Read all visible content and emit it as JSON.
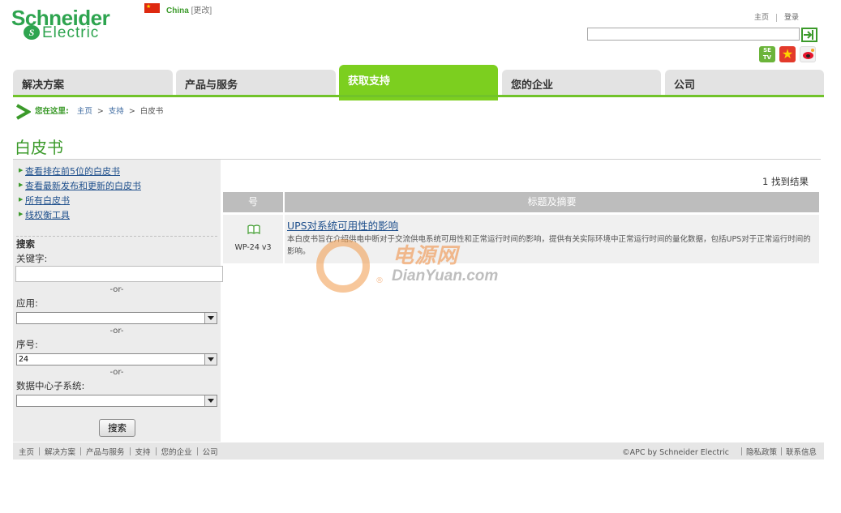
{
  "logo": {
    "line1": "Schneider",
    "line2": "Electric",
    "mark": "S"
  },
  "country": {
    "name": "China",
    "change": "[更改]"
  },
  "top_links": {
    "home": "主页",
    "login": "登录"
  },
  "search": {
    "placeholder": ""
  },
  "nav": {
    "tabs": [
      {
        "label": "解决方案"
      },
      {
        "label": "产品与服务"
      },
      {
        "label": "获取支持"
      },
      {
        "label": "您的企业"
      },
      {
        "label": "公司"
      }
    ],
    "active_tab": "获取支持",
    "accent_color": "#7ccf1f"
  },
  "breadcrumb": {
    "here_label": "您在这里:",
    "items": [
      "主页",
      "支持",
      "白皮书"
    ],
    "separator": ">"
  },
  "page": {
    "title": "白皮书"
  },
  "sidebar": {
    "links": [
      "查看排在前5位的白皮书",
      "查看最新发布和更新的白皮书",
      "所有白皮书",
      "线权衡工具"
    ],
    "search_heading": "搜索",
    "keyword_label": "关键字:",
    "or_text": "-or-",
    "application_label": "应用:",
    "application_value": "",
    "number_label": "序号:",
    "number_value": "24",
    "subsystem_label": "数据中心子系统:",
    "subsystem_value": "",
    "search_button": "搜索"
  },
  "results": {
    "count_text": "1 找到结果",
    "columns": [
      "号",
      "标题及摘要"
    ],
    "rows": [
      {
        "code": "WP-24 v3",
        "icon": "book-icon",
        "title": "UPS对系统可用性的影响",
        "abstract": "本白皮书旨在介绍供电中断对于交流供电系统可用性和正常运行时间的影响，提供有关实际环境中正常运行时间的量化数据，包括UPS对于正常运行时间的影响。"
      }
    ]
  },
  "watermark": {
    "cn": "电源网",
    "en": "DianYuan.com",
    "reg": "®"
  },
  "footer": {
    "links": [
      "主页",
      "解决方案",
      "产品与服务",
      "支持",
      "您的企业",
      "公司"
    ],
    "copyright": "©APC by Schneider Electric",
    "right_links": [
      "隐私政策",
      "联系信息"
    ]
  },
  "social": {
    "se_tv": "SE TV",
    "icons": [
      "se-tv-icon",
      "star-icon",
      "weibo-icon"
    ]
  }
}
